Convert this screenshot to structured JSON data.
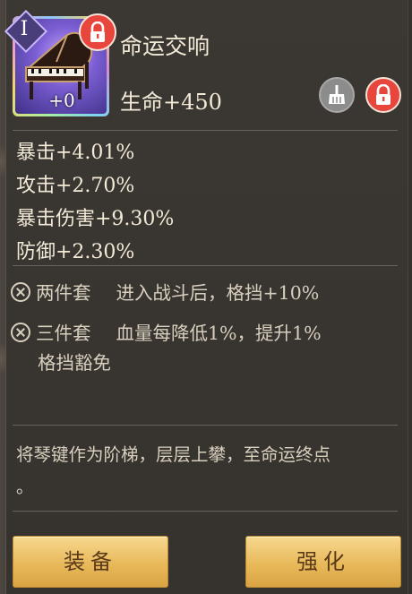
{
  "item": {
    "rank": "I",
    "level": "+0",
    "name": "命运交响",
    "main_stat": "生命+450"
  },
  "substats": [
    "暴击+4.01%",
    "攻击+2.70%",
    "暴击伤害+9.30%",
    "防御+2.30%"
  ],
  "set_bonuses": [
    {
      "name": "两件套",
      "effect": "进入战斗后，格挡+10%"
    },
    {
      "name": "三件套",
      "effect": "血量每降低1%，提升1%",
      "effect_cont": "格挡豁免"
    }
  ],
  "flavor_text": [
    "将琴键作为阶梯，层层上攀，至命运终点",
    "。"
  ],
  "buttons": {
    "equip": "装备",
    "upgrade": "强化"
  },
  "colors": {
    "lock_red": "#e8453c",
    "button_gold": "#e8b95a",
    "panel_bg": "#36322e"
  }
}
